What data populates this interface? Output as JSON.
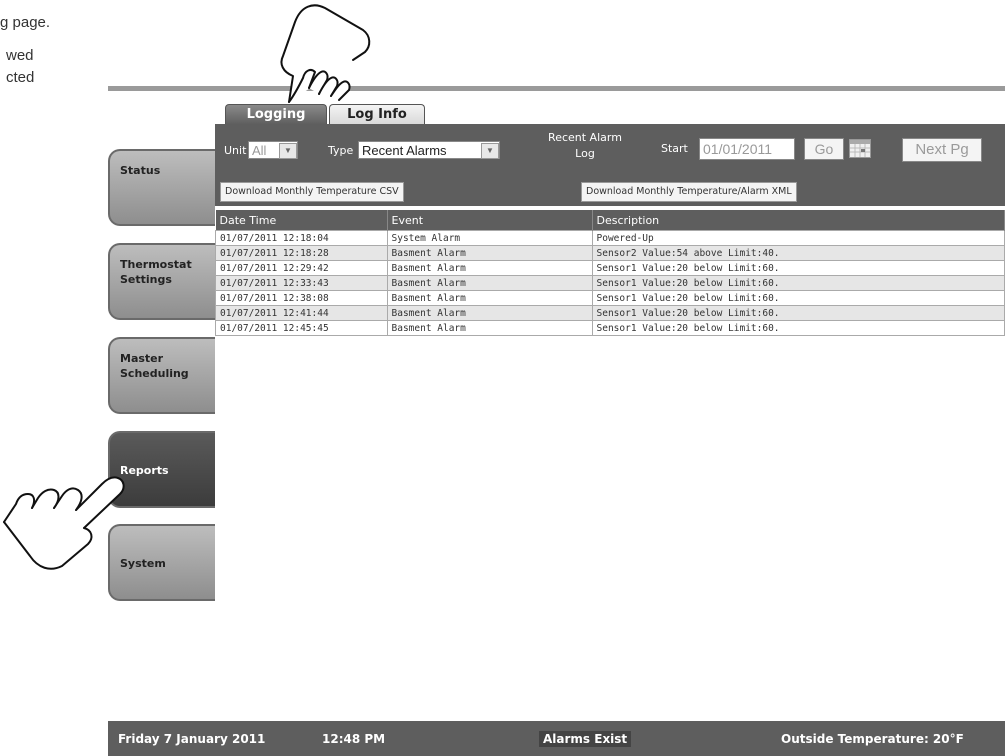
{
  "doc_text": {
    "line1": "g page.",
    "line2": "wed",
    "line3": "cted"
  },
  "tabs": [
    {
      "label": "Logging",
      "active": true
    },
    {
      "label": "Log Info",
      "active": false
    }
  ],
  "filters": {
    "unit_label": "Unit",
    "unit_value": "All",
    "type_label": "Type",
    "type_value": "Recent Alarms",
    "title_line1": "Recent Alarm",
    "title_line2": "Log",
    "start_label": "Start",
    "start_value": "01/01/2011",
    "go_label": "Go",
    "next_label": "Next Pg"
  },
  "downloads": {
    "csv_label": "Download Monthly Temperature CSV",
    "xml_label": "Download Monthly Temperature/Alarm XML"
  },
  "table": {
    "headers": [
      "Date   Time",
      "Event",
      "Description"
    ],
    "rows": [
      [
        "01/07/2011 12:18:04",
        "System Alarm",
        "Powered-Up"
      ],
      [
        "01/07/2011 12:18:28",
        "Basment Alarm",
        "Sensor2 Value:54 above Limit:40."
      ],
      [
        "01/07/2011 12:29:42",
        "Basment Alarm",
        "Sensor1 Value:20 below Limit:60."
      ],
      [
        "01/07/2011 12:33:43",
        "Basment Alarm",
        "Sensor1 Value:20 below Limit:60."
      ],
      [
        "01/07/2011 12:38:08",
        "Basment Alarm",
        "Sensor1 Value:20 below Limit:60."
      ],
      [
        "01/07/2011 12:41:44",
        "Basment Alarm",
        "Sensor1 Value:20 below Limit:60."
      ],
      [
        "01/07/2011 12:45:45",
        "Basment Alarm",
        "Sensor1 Value:20 below Limit:60."
      ]
    ]
  },
  "sidebar": {
    "items": [
      {
        "label": "Status",
        "active": false
      },
      {
        "label": "Thermostat Settings",
        "active": false
      },
      {
        "label": "Master Scheduling",
        "active": false
      },
      {
        "label": "Reports",
        "active": true
      },
      {
        "label": "System",
        "active": false
      }
    ]
  },
  "status_bar": {
    "date": "Friday  7 January 2011",
    "time": "12:48 PM",
    "alarm": "Alarms Exist",
    "outside_temp": "Outside Temperature: 20°F"
  },
  "icons": {
    "hand_top": "pointing-hand-icon",
    "hand_left": "pointing-hand-icon",
    "calendar": "calendar-icon",
    "select_arrow": "chevron-down-icon"
  }
}
